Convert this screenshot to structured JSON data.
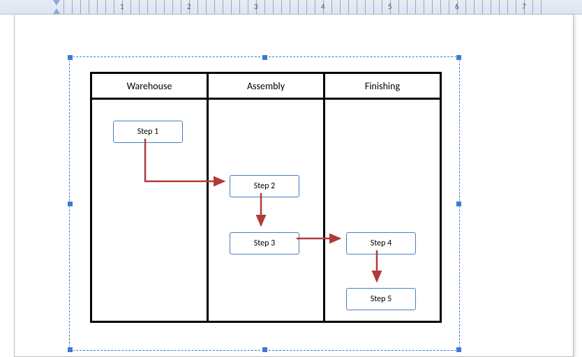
{
  "ruler": {
    "numbers": [
      "1",
      "2",
      "3",
      "4",
      "5",
      "6",
      "7"
    ]
  },
  "lanes": {
    "warehouse": "Warehouse",
    "assembly": "Assembly",
    "finishing": "Finishing"
  },
  "steps": {
    "s1": "Step 1",
    "s2": "Step 2",
    "s3": "Step 3",
    "s4": "Step 4",
    "s5": "Step 5"
  }
}
